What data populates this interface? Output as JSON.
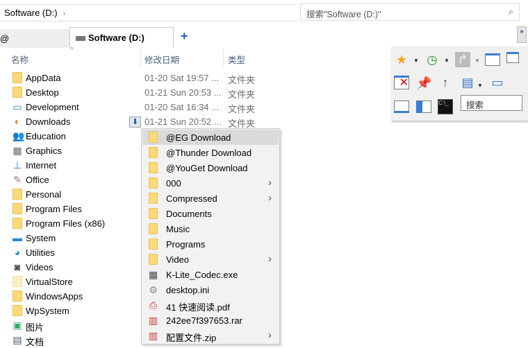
{
  "address": {
    "path": "Software (D:)",
    "chevron": "›"
  },
  "search": {
    "placeholder": "搜索\"Software (D:)\"",
    "icon": "search-icon"
  },
  "tabs": [
    {
      "label": "@"
    },
    {
      "label": "Software (D:)"
    }
  ],
  "new_tab": "+",
  "columns": {
    "sort_indicator": "^",
    "name": "名称",
    "date": "修改日期",
    "type": "类型"
  },
  "files": [
    {
      "name": "AppData",
      "date": "01-20 Sat 19:57 ...",
      "type": "文件夹",
      "icon": "folder"
    },
    {
      "name": "Desktop",
      "date": "01-21 Sun 20:53 ...",
      "type": "文件夹",
      "icon": "folder"
    },
    {
      "name": "Development",
      "date": "01-20 Sat 16:34 ...",
      "type": "文件夹",
      "icon": "dev"
    },
    {
      "name": "Downloads",
      "date": "01-21 Sun 20:52 ...",
      "type": "文件夹",
      "icon": "downloads"
    },
    {
      "name": "Education",
      "icon": "people"
    },
    {
      "name": "Graphics",
      "icon": "graphics"
    },
    {
      "name": "Internet",
      "icon": "network"
    },
    {
      "name": "Office",
      "icon": "office"
    },
    {
      "name": "Personal",
      "icon": "folder"
    },
    {
      "name": "Program Files",
      "icon": "folder"
    },
    {
      "name": "Program Files (x86)",
      "icon": "folder"
    },
    {
      "name": "System",
      "icon": "monitor"
    },
    {
      "name": "Utilities",
      "icon": "utilities"
    },
    {
      "name": "Videos",
      "icon": "camera"
    },
    {
      "name": "VirtualStore",
      "icon": "folder-light"
    },
    {
      "name": "WindowsApps",
      "icon": "folder"
    },
    {
      "name": "WpSystem",
      "icon": "folder"
    },
    {
      "name": "图片",
      "icon": "pictures"
    },
    {
      "name": "文档",
      "icon": "documents"
    }
  ],
  "submenu": [
    {
      "name": "@EG Download",
      "icon": "folder",
      "selected": true
    },
    {
      "name": "@Thunder Download",
      "icon": "folder"
    },
    {
      "name": "@YouGet Download",
      "icon": "folder"
    },
    {
      "name": "000",
      "icon": "folder",
      "arrow": "›"
    },
    {
      "name": "Compressed",
      "icon": "folder",
      "arrow": "›"
    },
    {
      "name": "Documents",
      "icon": "folder"
    },
    {
      "name": "Music",
      "icon": "folder"
    },
    {
      "name": "Programs",
      "icon": "folder"
    },
    {
      "name": "Video",
      "icon": "folder",
      "arrow": "›"
    },
    {
      "name": "K-Lite_Codec.exe",
      "icon": "exe"
    },
    {
      "name": "desktop.ini",
      "icon": "ini"
    },
    {
      "name": "41 快速阅读.pdf",
      "icon": "pdf"
    },
    {
      "name": "242ee7f397653.rar",
      "icon": "rar"
    },
    {
      "name": "配置文件.zip",
      "icon": "rar",
      "arrow": "›"
    }
  ],
  "toolbar": {
    "search_placeholder": "搜索",
    "expand": "»"
  }
}
